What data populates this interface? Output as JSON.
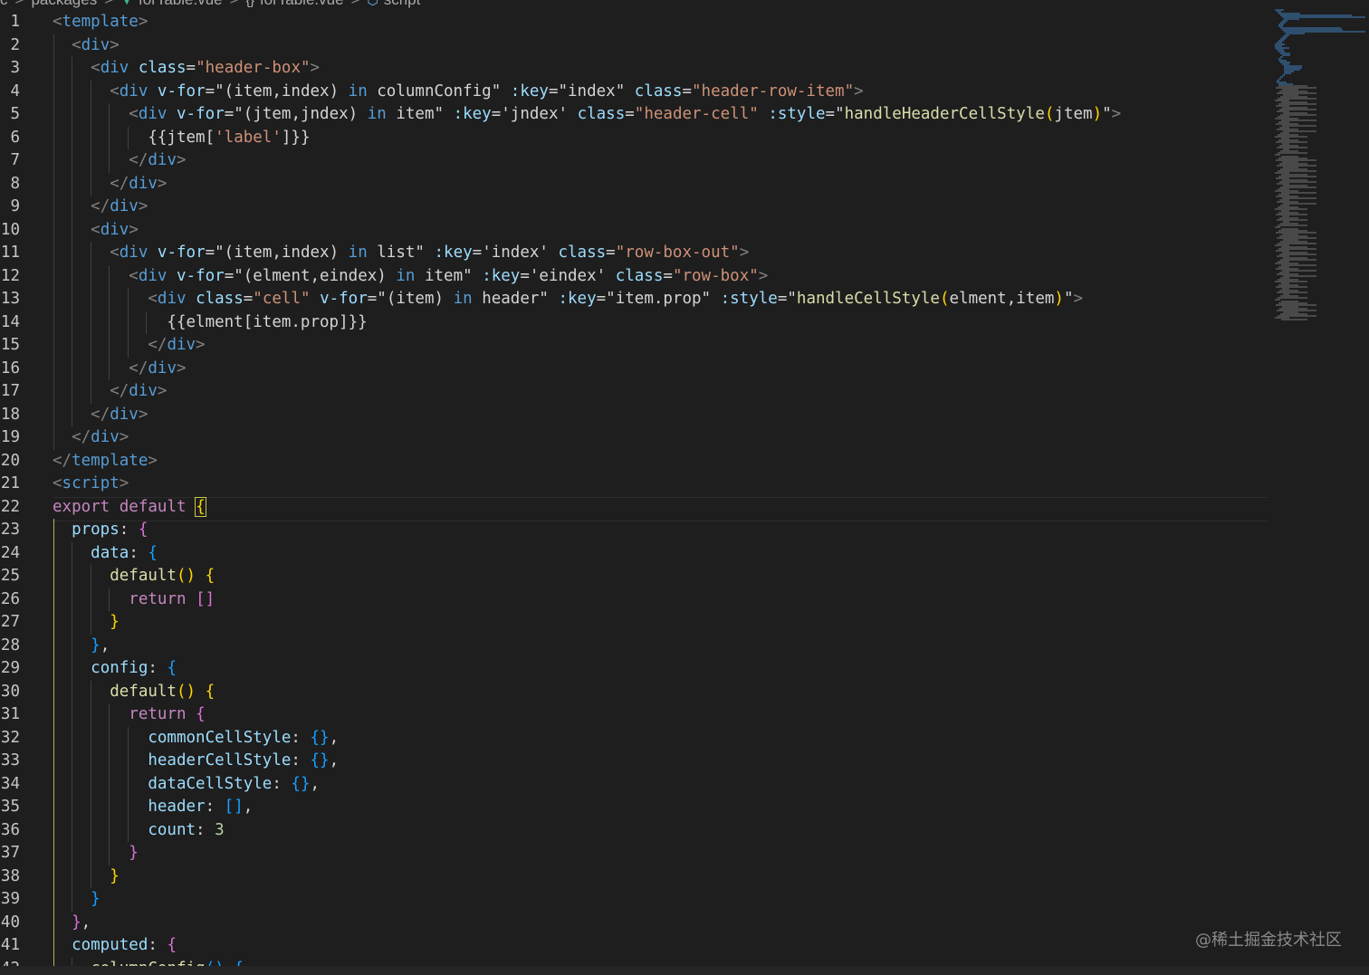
{
  "breadcrumb": {
    "segments": [
      {
        "label": "packages",
        "icon": ""
      },
      {
        "label": "forTable.vue",
        "icon": "vue-file-icon"
      },
      {
        "label": "forTable.vue",
        "icon": "braces-icon"
      },
      {
        "label": "script",
        "icon": "cube-icon"
      }
    ],
    "leading": "c",
    "separator": ">"
  },
  "editor": {
    "lines": [
      {
        "n": "1",
        "tokens": [
          [
            "punc",
            "<"
          ],
          [
            "tag",
            "template"
          ],
          [
            "punc",
            ">"
          ]
        ]
      },
      {
        "n": "2",
        "tokens": [
          [
            "txt",
            "  "
          ],
          [
            "punc",
            "<"
          ],
          [
            "tag",
            "div"
          ],
          [
            "punc",
            ">"
          ]
        ]
      },
      {
        "n": "3",
        "tokens": [
          [
            "txt",
            "    "
          ],
          [
            "punc",
            "<"
          ],
          [
            "tag",
            "div"
          ],
          [
            "txt",
            " "
          ],
          [
            "attr",
            "class"
          ],
          [
            "txt",
            "="
          ],
          [
            "str",
            "\"header-box\""
          ],
          [
            "punc",
            ">"
          ]
        ]
      },
      {
        "n": "4",
        "tokens": [
          [
            "txt",
            "      "
          ],
          [
            "punc",
            "<"
          ],
          [
            "tag",
            "div"
          ],
          [
            "txt",
            " "
          ],
          [
            "attr",
            "v-for"
          ],
          [
            "txt",
            "=\"(item,index) "
          ],
          [
            "kwb",
            "in"
          ],
          [
            "txt",
            " columnConfig\" "
          ],
          [
            "attr",
            ":key"
          ],
          [
            "txt",
            "=\"index\" "
          ],
          [
            "attr",
            "class"
          ],
          [
            "txt",
            "="
          ],
          [
            "str",
            "\"header-row-item\""
          ],
          [
            "punc",
            ">"
          ]
        ]
      },
      {
        "n": "5",
        "tokens": [
          [
            "txt",
            "        "
          ],
          [
            "punc",
            "<"
          ],
          [
            "tag",
            "div"
          ],
          [
            "txt",
            " "
          ],
          [
            "attr",
            "v-for"
          ],
          [
            "txt",
            "=\"(jtem,jndex) "
          ],
          [
            "kwb",
            "in"
          ],
          [
            "txt",
            " item\" "
          ],
          [
            "attr",
            ":key"
          ],
          [
            "txt",
            "='jndex' "
          ],
          [
            "attr",
            "class"
          ],
          [
            "txt",
            "="
          ],
          [
            "str",
            "\"header-cell\""
          ],
          [
            "txt",
            " "
          ],
          [
            "attr",
            ":style"
          ],
          [
            "txt",
            "=\""
          ],
          [
            "fn",
            "handleHeaderCellStyle"
          ],
          [
            "b1",
            "("
          ],
          [
            "txt",
            "jtem"
          ],
          [
            "b1",
            ")"
          ],
          [
            "txt",
            "\""
          ],
          [
            "punc",
            ">"
          ]
        ]
      },
      {
        "n": "6",
        "tokens": [
          [
            "txt",
            "          {{jtem["
          ],
          [
            "str",
            "'label'"
          ],
          [
            "txt",
            "]}}"
          ]
        ]
      },
      {
        "n": "7",
        "tokens": [
          [
            "txt",
            "        "
          ],
          [
            "punc",
            "</"
          ],
          [
            "tag",
            "div"
          ],
          [
            "punc",
            ">"
          ]
        ]
      },
      {
        "n": "8",
        "tokens": [
          [
            "txt",
            "      "
          ],
          [
            "punc",
            "</"
          ],
          [
            "tag",
            "div"
          ],
          [
            "punc",
            ">"
          ]
        ]
      },
      {
        "n": "9",
        "tokens": [
          [
            "txt",
            "    "
          ],
          [
            "punc",
            "</"
          ],
          [
            "tag",
            "div"
          ],
          [
            "punc",
            ">"
          ]
        ]
      },
      {
        "n": "10",
        "tokens": [
          [
            "txt",
            "    "
          ],
          [
            "punc",
            "<"
          ],
          [
            "tag",
            "div"
          ],
          [
            "punc",
            ">"
          ]
        ]
      },
      {
        "n": "11",
        "tokens": [
          [
            "txt",
            "      "
          ],
          [
            "punc",
            "<"
          ],
          [
            "tag",
            "div"
          ],
          [
            "txt",
            " "
          ],
          [
            "attr",
            "v-for"
          ],
          [
            "txt",
            "=\"(item,index) "
          ],
          [
            "kwb",
            "in"
          ],
          [
            "txt",
            " list\" "
          ],
          [
            "attr",
            ":key"
          ],
          [
            "txt",
            "='index' "
          ],
          [
            "attr",
            "class"
          ],
          [
            "txt",
            "="
          ],
          [
            "str",
            "\"row-box-out\""
          ],
          [
            "punc",
            ">"
          ]
        ]
      },
      {
        "n": "12",
        "tokens": [
          [
            "txt",
            "        "
          ],
          [
            "punc",
            "<"
          ],
          [
            "tag",
            "div"
          ],
          [
            "txt",
            " "
          ],
          [
            "attr",
            "v-for"
          ],
          [
            "txt",
            "=\"(elment,eindex) "
          ],
          [
            "kwb",
            "in"
          ],
          [
            "txt",
            " item\" "
          ],
          [
            "attr",
            ":key"
          ],
          [
            "txt",
            "='eindex' "
          ],
          [
            "attr",
            "class"
          ],
          [
            "txt",
            "="
          ],
          [
            "str",
            "\"row-box\""
          ],
          [
            "punc",
            ">"
          ]
        ]
      },
      {
        "n": "13",
        "tokens": [
          [
            "txt",
            "          "
          ],
          [
            "punc",
            "<"
          ],
          [
            "tag",
            "div"
          ],
          [
            "txt",
            " "
          ],
          [
            "attr",
            "class"
          ],
          [
            "txt",
            "="
          ],
          [
            "str",
            "\"cell\""
          ],
          [
            "txt",
            " "
          ],
          [
            "attr",
            "v-for"
          ],
          [
            "txt",
            "=\"(item) "
          ],
          [
            "kwb",
            "in"
          ],
          [
            "txt",
            " header\" "
          ],
          [
            "attr",
            ":key"
          ],
          [
            "txt",
            "=\"item.prop\" "
          ],
          [
            "attr",
            ":style"
          ],
          [
            "txt",
            "=\""
          ],
          [
            "fn",
            "handleCellStyle"
          ],
          [
            "b1",
            "("
          ],
          [
            "txt",
            "elment,item"
          ],
          [
            "b1",
            ")"
          ],
          [
            "txt",
            "\""
          ],
          [
            "punc",
            ">"
          ]
        ]
      },
      {
        "n": "14",
        "tokens": [
          [
            "txt",
            "            {{elment[item.prop]}}"
          ]
        ]
      },
      {
        "n": "15",
        "tokens": [
          [
            "txt",
            "          "
          ],
          [
            "punc",
            "</"
          ],
          [
            "tag",
            "div"
          ],
          [
            "punc",
            ">"
          ]
        ]
      },
      {
        "n": "16",
        "tokens": [
          [
            "txt",
            "        "
          ],
          [
            "punc",
            "</"
          ],
          [
            "tag",
            "div"
          ],
          [
            "punc",
            ">"
          ]
        ]
      },
      {
        "n": "17",
        "tokens": [
          [
            "txt",
            "      "
          ],
          [
            "punc",
            "</"
          ],
          [
            "tag",
            "div"
          ],
          [
            "punc",
            ">"
          ]
        ]
      },
      {
        "n": "18",
        "tokens": [
          [
            "txt",
            "    "
          ],
          [
            "punc",
            "</"
          ],
          [
            "tag",
            "div"
          ],
          [
            "punc",
            ">"
          ]
        ]
      },
      {
        "n": "19",
        "tokens": [
          [
            "txt",
            "  "
          ],
          [
            "punc",
            "</"
          ],
          [
            "tag",
            "div"
          ],
          [
            "punc",
            ">"
          ]
        ]
      },
      {
        "n": "20",
        "tokens": [
          [
            "punc",
            "</"
          ],
          [
            "tag",
            "template"
          ],
          [
            "punc",
            ">"
          ]
        ]
      },
      {
        "n": "21",
        "tokens": [
          [
            "punc",
            "<"
          ],
          [
            "tag",
            "script"
          ],
          [
            "punc",
            ">"
          ]
        ]
      },
      {
        "n": "22",
        "tokens": [
          [
            "kw",
            "export"
          ],
          [
            "txt",
            " "
          ],
          [
            "kw",
            "default"
          ],
          [
            "txt",
            " "
          ],
          [
            "b1m",
            "{"
          ]
        ]
      },
      {
        "n": "23",
        "tokens": [
          [
            "txt",
            "  "
          ],
          [
            "prop",
            "props"
          ],
          [
            "txt",
            ": "
          ],
          [
            "b2",
            "{"
          ]
        ]
      },
      {
        "n": "24",
        "tokens": [
          [
            "txt",
            "    "
          ],
          [
            "prop",
            "data"
          ],
          [
            "txt",
            ": "
          ],
          [
            "b3",
            "{"
          ]
        ]
      },
      {
        "n": "25",
        "tokens": [
          [
            "txt",
            "      "
          ],
          [
            "fn",
            "default"
          ],
          [
            "b1",
            "()"
          ],
          [
            "txt",
            " "
          ],
          [
            "b1",
            "{"
          ]
        ]
      },
      {
        "n": "26",
        "tokens": [
          [
            "txt",
            "        "
          ],
          [
            "kw",
            "return"
          ],
          [
            "txt",
            " "
          ],
          [
            "b2",
            "[]"
          ]
        ]
      },
      {
        "n": "27",
        "tokens": [
          [
            "txt",
            "      "
          ],
          [
            "b1",
            "}"
          ]
        ]
      },
      {
        "n": "28",
        "tokens": [
          [
            "txt",
            "    "
          ],
          [
            "b3",
            "}"
          ],
          [
            "txt",
            ","
          ]
        ]
      },
      {
        "n": "29",
        "tokens": [
          [
            "txt",
            "    "
          ],
          [
            "prop",
            "config"
          ],
          [
            "txt",
            ": "
          ],
          [
            "b3",
            "{"
          ]
        ]
      },
      {
        "n": "30",
        "tokens": [
          [
            "txt",
            "      "
          ],
          [
            "fn",
            "default"
          ],
          [
            "b1",
            "()"
          ],
          [
            "txt",
            " "
          ],
          [
            "b1",
            "{"
          ]
        ]
      },
      {
        "n": "31",
        "tokens": [
          [
            "txt",
            "        "
          ],
          [
            "kw",
            "return"
          ],
          [
            "txt",
            " "
          ],
          [
            "b2",
            "{"
          ]
        ]
      },
      {
        "n": "32",
        "tokens": [
          [
            "txt",
            "          "
          ],
          [
            "prop",
            "commonCellStyle"
          ],
          [
            "txt",
            ": "
          ],
          [
            "b3",
            "{}"
          ],
          [
            "txt",
            ","
          ]
        ]
      },
      {
        "n": "33",
        "tokens": [
          [
            "txt",
            "          "
          ],
          [
            "prop",
            "headerCellStyle"
          ],
          [
            "txt",
            ": "
          ],
          [
            "b3",
            "{}"
          ],
          [
            "txt",
            ","
          ]
        ]
      },
      {
        "n": "34",
        "tokens": [
          [
            "txt",
            "          "
          ],
          [
            "prop",
            "dataCellStyle"
          ],
          [
            "txt",
            ": "
          ],
          [
            "b3",
            "{}"
          ],
          [
            "txt",
            ","
          ]
        ]
      },
      {
        "n": "35",
        "tokens": [
          [
            "txt",
            "          "
          ],
          [
            "prop",
            "header"
          ],
          [
            "txt",
            ": "
          ],
          [
            "b3",
            "[]"
          ],
          [
            "txt",
            ","
          ]
        ]
      },
      {
        "n": "36",
        "tokens": [
          [
            "txt",
            "          "
          ],
          [
            "prop",
            "count"
          ],
          [
            "txt",
            ": "
          ],
          [
            "num",
            "3"
          ]
        ]
      },
      {
        "n": "37",
        "tokens": [
          [
            "txt",
            "        "
          ],
          [
            "b2",
            "}"
          ]
        ]
      },
      {
        "n": "38",
        "tokens": [
          [
            "txt",
            "      "
          ],
          [
            "b1",
            "}"
          ]
        ]
      },
      {
        "n": "39",
        "tokens": [
          [
            "txt",
            "    "
          ],
          [
            "b3",
            "}"
          ]
        ]
      },
      {
        "n": "40",
        "tokens": [
          [
            "txt",
            "  "
          ],
          [
            "b2",
            "}"
          ],
          [
            "txt",
            ","
          ]
        ]
      },
      {
        "n": "41",
        "tokens": [
          [
            "txt",
            "  "
          ],
          [
            "prop",
            "computed"
          ],
          [
            "txt",
            ": "
          ],
          [
            "b2",
            "{"
          ]
        ]
      },
      {
        "n": "42",
        "tokens": [
          [
            "txt",
            "    "
          ],
          [
            "fn",
            "columnConfig"
          ],
          [
            "b3",
            "()"
          ],
          [
            "txt",
            " "
          ],
          [
            "b3",
            "{"
          ]
        ]
      }
    ]
  },
  "watermark": "@稀土掘金技术社区",
  "colors": {
    "background": "#1e1e1e",
    "tag": "#569cd6",
    "string": "#ce9178",
    "attribute": "#9cdcfe",
    "keyword": "#c586c0",
    "function": "#dcdcaa",
    "bracket_gold": "#ffd700",
    "bracket_purple": "#da70d6",
    "bracket_blue": "#179fff"
  }
}
